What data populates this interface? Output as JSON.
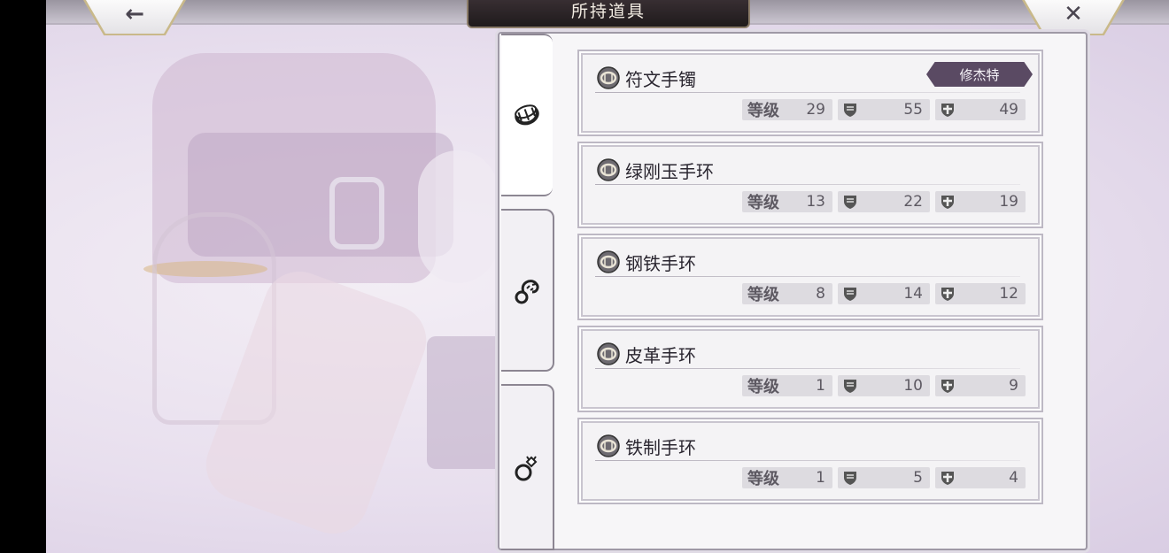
{
  "header": {
    "title": "所持道具",
    "back_glyph": "←",
    "close_glyph": "✕"
  },
  "tabs": [
    {
      "icon": "bracelet-icon",
      "active": true
    },
    {
      "icon": "ring-claw-icon",
      "active": false
    },
    {
      "icon": "ring-icon",
      "active": false
    }
  ],
  "stat_labels": {
    "level": "等级"
  },
  "items": [
    {
      "name": "符文手镯",
      "owner": "修杰特",
      "level": "29",
      "defense": "55",
      "resistance": "49"
    },
    {
      "name": "绿刚玉手环",
      "owner": "",
      "level": "13",
      "defense": "22",
      "resistance": "19"
    },
    {
      "name": "钢铁手环",
      "owner": "",
      "level": "8",
      "defense": "14",
      "resistance": "12"
    },
    {
      "name": "皮革手环",
      "owner": "",
      "level": "1",
      "defense": "10",
      "resistance": "9"
    },
    {
      "name": "铁制手环",
      "owner": "",
      "level": "1",
      "defense": "5",
      "resistance": "4"
    }
  ],
  "colors": {
    "owner_tag": "#5a4a63",
    "stat_bg": "#dddbe0",
    "title_plate": "#2a2326"
  }
}
